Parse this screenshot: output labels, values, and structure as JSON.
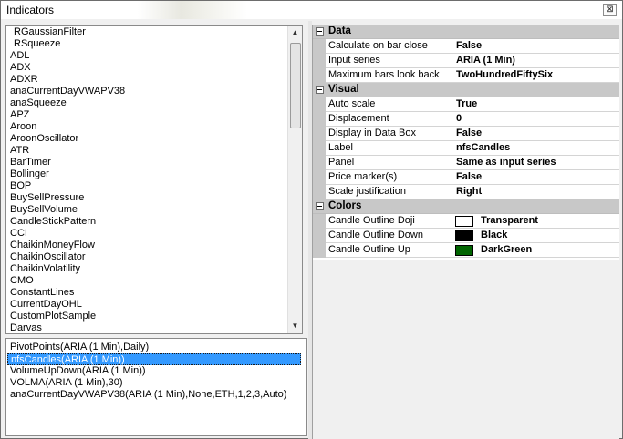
{
  "window": {
    "title": "Indicators",
    "close_glyph": "⊠"
  },
  "indicator_list": {
    "items": [
      "RGaussianFilter",
      "RSqueeze",
      "ADL",
      "ADX",
      "ADXR",
      "anaCurrentDayVWAPV38",
      "anaSqueeze",
      "APZ",
      "Aroon",
      "AroonOscillator",
      "ATR",
      "BarTimer",
      "Bollinger",
      "BOP",
      "BuySellPressure",
      "BuySellVolume",
      "CandleStickPattern",
      "CCI",
      "ChaikinMoneyFlow",
      "ChaikinOscillator",
      "ChaikinVolatility",
      "CMO",
      "ConstantLines",
      "CurrentDayOHL",
      "CustomPlotSample",
      "Darvas"
    ],
    "scroll_up_glyph": "▲",
    "scroll_down_glyph": "▼"
  },
  "applied_list": {
    "items": [
      "PivotPoints(ARIA (1 Min),Daily)",
      "nfsCandles(ARIA (1 Min))",
      "VolumeUpDown(ARIA (1 Min))",
      "VOLMA(ARIA (1 Min),30)",
      "anaCurrentDayVWAPV38(ARIA (1 Min),None,ETH,1,2,3,Auto)"
    ],
    "selected_index": 1
  },
  "properties": {
    "data": {
      "label": "Data",
      "rows": [
        {
          "name": "Calculate on bar close",
          "value": "False"
        },
        {
          "name": "Input series",
          "value": "ARIA (1 Min)"
        },
        {
          "name": "Maximum bars look back",
          "value": "TwoHundredFiftySix"
        }
      ]
    },
    "visual": {
      "label": "Visual",
      "rows": [
        {
          "name": "Auto scale",
          "value": "True"
        },
        {
          "name": "Displacement",
          "value": "0"
        },
        {
          "name": "Display in Data Box",
          "value": "False"
        },
        {
          "name": "Label",
          "value": "nfsCandles"
        },
        {
          "name": "Panel",
          "value": "Same as input series"
        },
        {
          "name": "Price marker(s)",
          "value": "False"
        },
        {
          "name": "Scale justification",
          "value": "Right"
        }
      ]
    },
    "colors": {
      "label": "Colors",
      "rows": [
        {
          "name": "Candle Outline Doji",
          "value": "Transparent",
          "swatch": "#ffffff"
        },
        {
          "name": "Candle Outline Down",
          "value": "Black",
          "swatch": "#000000"
        },
        {
          "name": "Candle Outline Up",
          "value": "DarkGreen",
          "swatch": "#006400"
        }
      ]
    }
  }
}
